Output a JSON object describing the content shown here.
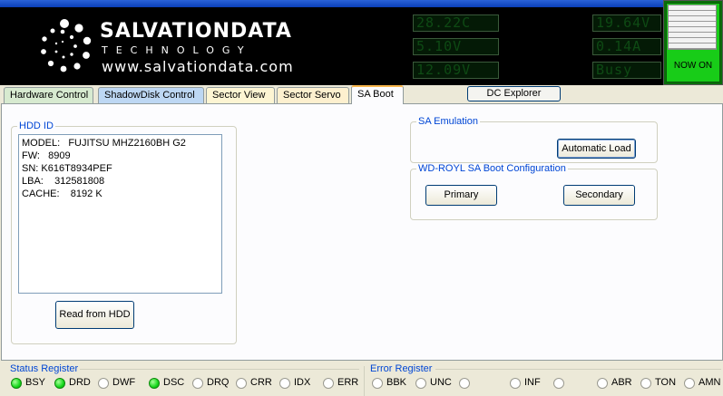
{
  "header": {
    "brand_name": "SALVATIONDATA",
    "brand_tagline": "TECHNOLOGY",
    "brand_url": "www.salvationdata.com",
    "lcd_temp": "28.22C",
    "lcd_v5": "5.10V",
    "lcd_v12": "12.09V",
    "lcd_power_v": "19.64V",
    "lcd_current": "0.14A",
    "lcd_state": "Busy",
    "power_label": "NOW ON"
  },
  "tabs": [
    {
      "label": "Hardware Control",
      "color": "#d7ead0"
    },
    {
      "label": "ShadowDisk Control",
      "color": "#bdd7f3"
    },
    {
      "label": "Sector View",
      "color": "#fdf5d3"
    },
    {
      "label": "Sector Servo",
      "color": "#fdf0cf"
    },
    {
      "label": "SA Boot",
      "color": "#fcfcfe"
    }
  ],
  "dc_explorer_label": "DC Explorer",
  "hdd_id": {
    "title": "HDD ID",
    "lines": [
      "MODEL:   FUJITSU MHZ2160BH G2",
      "FW:   8909",
      "SN: K616T8934PEF",
      "LBA:    312581808",
      "CACHE:    8192 K"
    ],
    "read_button": "Read from HDD"
  },
  "sa_emulation": {
    "title": "SA Emulation",
    "auto_load_button": "Automatic Load"
  },
  "wd_royl": {
    "title": "WD-ROYL SA Boot Configuration",
    "primary_button": "Primary",
    "secondary_button": "Secondary"
  },
  "status_register": {
    "title": "Status Register",
    "bits": [
      {
        "label": "BSY",
        "on": true
      },
      {
        "label": "DRD",
        "on": true
      },
      {
        "label": "DWF",
        "on": false
      },
      {
        "label": "DSC",
        "on": true
      },
      {
        "label": "DRQ",
        "on": false
      },
      {
        "label": "CRR",
        "on": false
      },
      {
        "label": "IDX",
        "on": false
      },
      {
        "label": "ERR",
        "on": false
      }
    ]
  },
  "error_register": {
    "title": "Error Register",
    "bits": [
      {
        "label": "BBK",
        "on": false
      },
      {
        "label": "UNC",
        "on": false
      },
      {
        "label": "",
        "on": false
      },
      {
        "label": "INF",
        "on": false
      },
      {
        "label": "",
        "on": false
      },
      {
        "label": "ABR",
        "on": false
      },
      {
        "label": "TON",
        "on": false
      },
      {
        "label": "AMN",
        "on": false
      }
    ]
  }
}
